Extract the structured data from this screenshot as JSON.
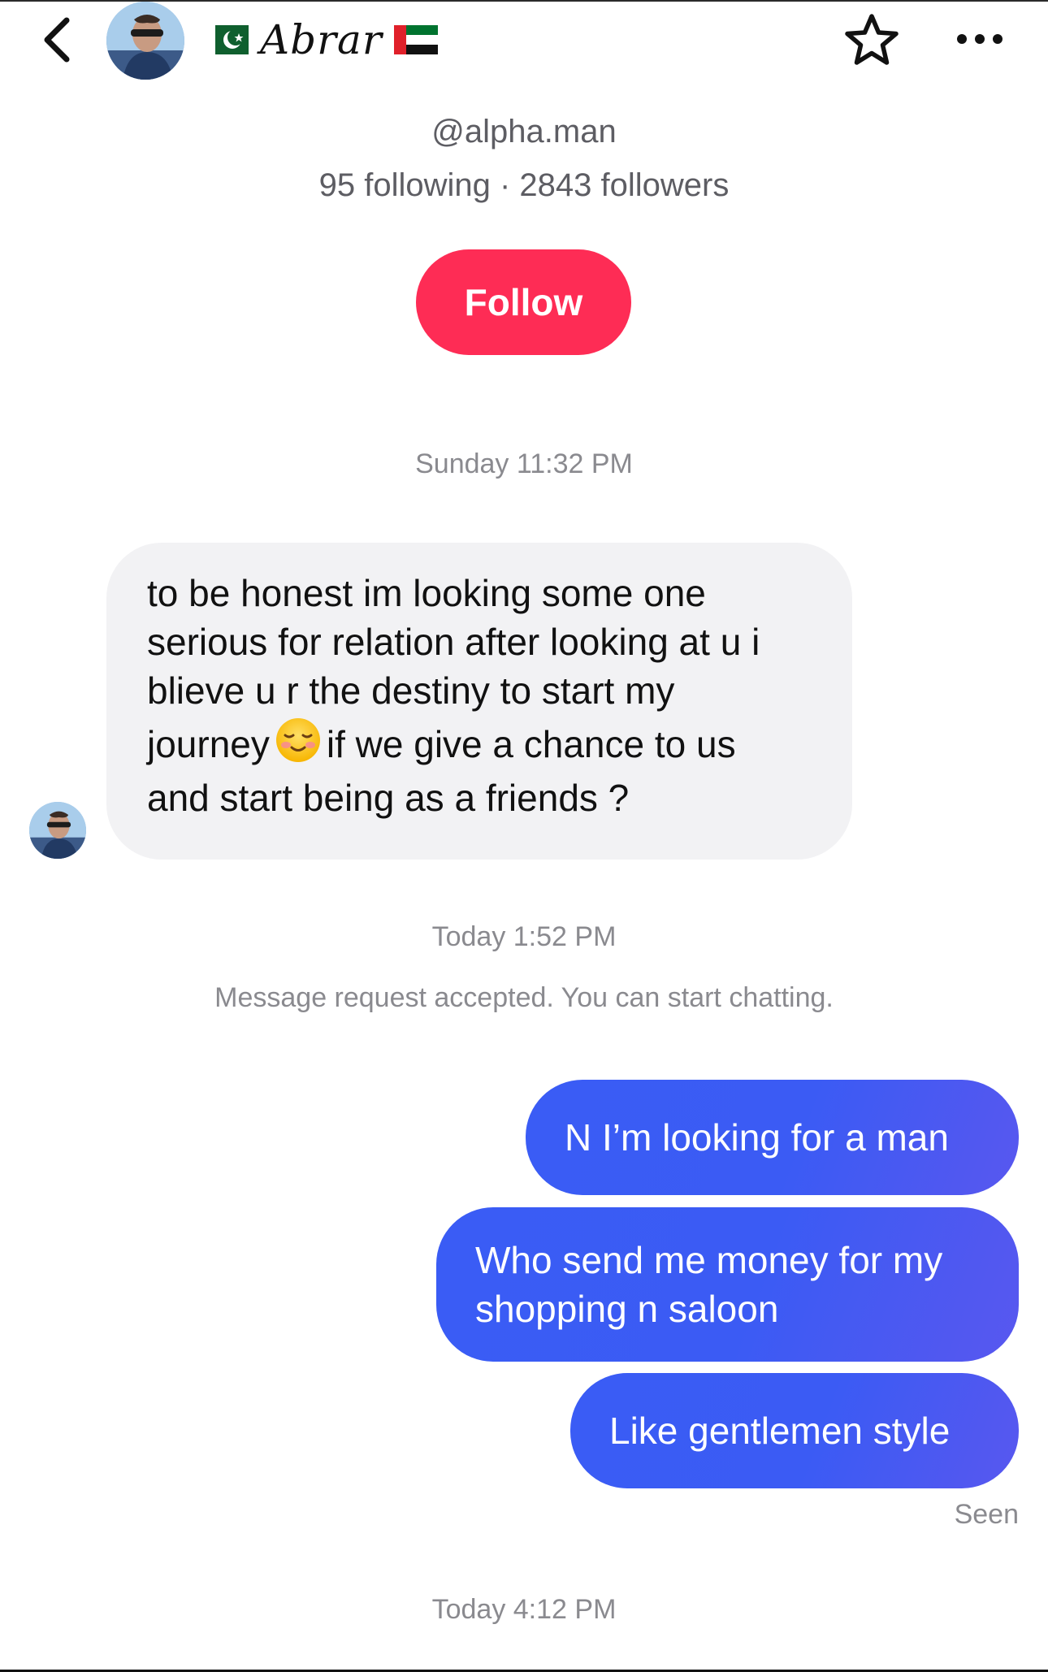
{
  "header": {
    "back_icon": "chevron-left-icon",
    "display_name": "Abrar",
    "flag_left": "pakistan-flag",
    "flag_right": "uae-flag",
    "star_icon": "star-outline-icon",
    "more_icon": "more-horizontal-icon"
  },
  "profile": {
    "handle": "@alpha.man",
    "stats": "95 following · 2843 followers",
    "follow_label": "Follow"
  },
  "conversation": {
    "timestamp_1": "Sunday 11:32 PM",
    "incoming_line_1": "to be honest im looking some one",
    "incoming_line_2": "serious for relation after looking at u i",
    "incoming_line_3": "blieve u r the destiny to start my",
    "incoming_line_4a": "journey",
    "incoming_line_4b": "if we give a chance to us",
    "incoming_line_5": "and start being as a friends ?",
    "incoming_emoji": "smiling-face-icon",
    "timestamp_2": "Today 1:52 PM",
    "system_note": "Message request accepted. You can start chatting.",
    "outgoing": [
      {
        "text_1": "N I’m looking for a man",
        "text_2": ""
      },
      {
        "text_1": "Who send me money for my",
        "text_2": "shopping n saloon"
      },
      {
        "text_1": "Like gentlemen style",
        "text_2": ""
      }
    ],
    "seen_label": "Seen",
    "timestamp_3": "Today 4:12 PM"
  },
  "colors": {
    "follow_button": "#fe2c55",
    "outgoing_bubble": "#3b5bf4",
    "incoming_bubble": "#f2f2f4",
    "secondary_text": "#8a8a8f"
  }
}
